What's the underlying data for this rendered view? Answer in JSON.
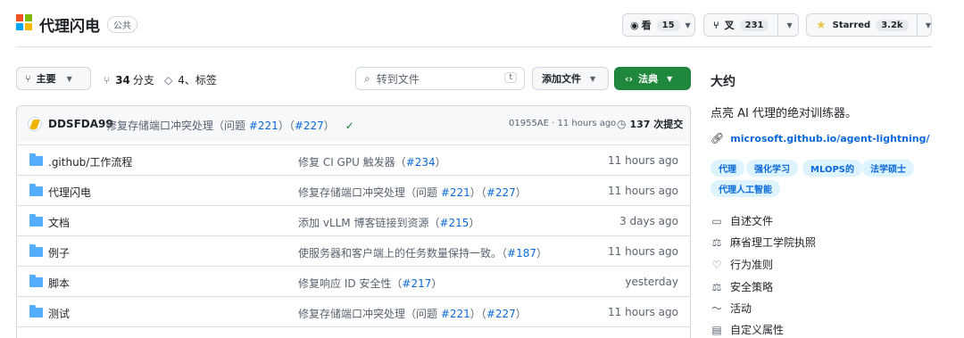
{
  "repo": {
    "name": "代理闪电",
    "visibility": "公共",
    "logo_colors": [
      "#f25022",
      "#7fba00",
      "#00a4ef",
      "#ffb900"
    ]
  },
  "header_actions": {
    "watch_label": "看",
    "watch_count": "15",
    "fork_label": "叉",
    "fork_count": "231",
    "star_label": "Starred",
    "star_count": "3.2k"
  },
  "toolbar": {
    "branch_label": "主要",
    "branches_count": "34",
    "branches_label": "分支",
    "tags_text": "4、标签",
    "search_placeholder": "转到文件",
    "search_shortcut": "t",
    "add_file_label": "添加文件",
    "code_label": "法典"
  },
  "commit": {
    "author": "DDSFDA99",
    "message": "修复存储端口冲突处理（问题",
    "issue": "#221",
    "pr": "#227",
    "sha_time": "01955AE · 11 hours ago",
    "commits_count_label": "137 次提交"
  },
  "files": [
    {
      "name": ".github/工作流程",
      "message": "修复 CI GPU 触发器（",
      "ref": "#234",
      "suffix": "）",
      "time": "11 hours ago"
    },
    {
      "name": "代理闪电",
      "message": "修复存储端口冲突处理（问题 ",
      "ref": "#221",
      "suffix": "）（",
      "ref2": "#227",
      "suffix2": "）",
      "time": "11 hours ago"
    },
    {
      "name": "文档",
      "message": "添加 vLLM 博客链接到资源（",
      "ref": "#215",
      "suffix": "）",
      "time": "3 days ago"
    },
    {
      "name": "例子",
      "message": "使服务器和客户端上的任务数量保持一致。（",
      "ref": "#187",
      "suffix": "）",
      "time": "11 hours ago"
    },
    {
      "name": "脚本",
      "message": "修复响应 ID 安全性（",
      "ref": "#217",
      "suffix": "）",
      "time": "yesterday"
    },
    {
      "name": "测试",
      "message": "修复存储端口冲突处理（问题 ",
      "ref": "#221",
      "suffix": "）（",
      "ref2": "#227",
      "suffix2": "）",
      "time": "11 hours ago"
    }
  ],
  "about": {
    "heading": "大约",
    "description": "点亮 AI 代理的绝对训练器。",
    "website": "microsoft.github.io/agent-lightning/",
    "topics": [
      "代理",
      "强化学习",
      "MLOPS的",
      "法学硕士",
      "代理人工智能"
    ],
    "links": [
      {
        "icon": "book-icon",
        "label": "自述文件"
      },
      {
        "icon": "scale-icon",
        "label": "麻省理工学院执照"
      },
      {
        "icon": "heart-icon",
        "label": "行为准则"
      },
      {
        "icon": "scale-icon",
        "label": "安全策略"
      },
      {
        "icon": "pulse-icon",
        "label": "活动"
      },
      {
        "icon": "note-icon",
        "label": "自定义属性"
      }
    ]
  },
  "colors": {
    "accent": "#0969da",
    "code_button": "#1f883d",
    "star": "#eac54f",
    "folder": "#54aeff",
    "check": "#1a7f37"
  }
}
